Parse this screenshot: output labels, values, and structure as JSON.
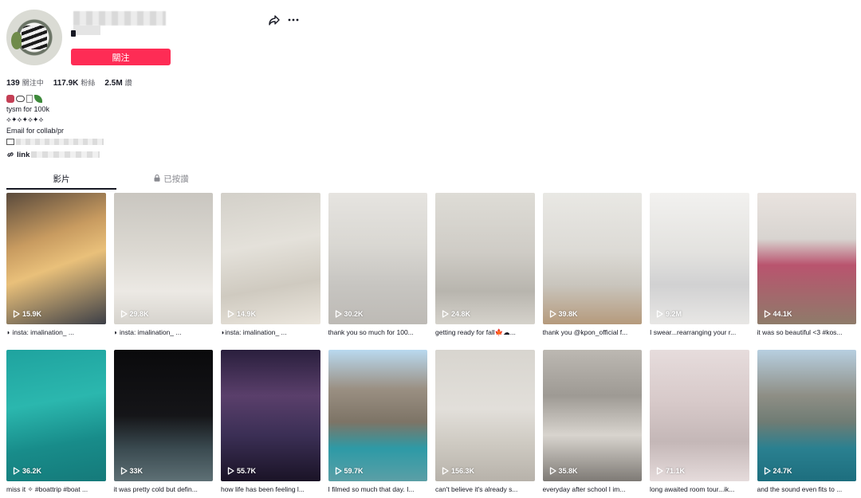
{
  "profile": {
    "follow_label": "關注",
    "stats": [
      {
        "value": "139",
        "label": "關注中"
      },
      {
        "value": "117.9K",
        "label": "粉絲"
      },
      {
        "value": "2.5M",
        "label": "讚"
      }
    ],
    "bio": {
      "line2": "tysm for 100k",
      "line3": "⟡✦⟡✦⟡✦⟡",
      "line4": "Email for collab/pr",
      "link_label": "link"
    }
  },
  "tabs": [
    {
      "label": "影片",
      "active": true
    },
    {
      "label": "已按讚",
      "active": false,
      "icon": "lock-icon"
    }
  ],
  "videos": [
    {
      "views": "15.9K",
      "caption": "◗ insta: imalination_ ..."
    },
    {
      "views": "29.8K",
      "caption": "◗ insta: imalination_ ..."
    },
    {
      "views": "14.9K",
      "caption": "◗insta: imalination_ ..."
    },
    {
      "views": "30.2K",
      "caption": "thank you so much for 100..."
    },
    {
      "views": "24.8K",
      "caption": "getting ready for fall🍁☁..."
    },
    {
      "views": "39.8K",
      "caption": "thank you @kpon_official f..."
    },
    {
      "views": "9.2M",
      "caption": "I swear...rearranging your r..."
    },
    {
      "views": "44.1K",
      "caption": "it was so beautiful <3 #kos..."
    },
    {
      "views": "36.2K",
      "caption": "miss it ✧ #boattrip #boat ..."
    },
    {
      "views": "33K",
      "caption": "it was pretty cold but defin..."
    },
    {
      "views": "55.7K",
      "caption": "how life has been feeling l..."
    },
    {
      "views": "59.7K",
      "caption": "I filmed so much that day. I..."
    },
    {
      "views": "156.3K",
      "caption": "can't believe it's already s..."
    },
    {
      "views": "35.8K",
      "caption": "everyday after school I im..."
    },
    {
      "views": "71.1K",
      "caption": "long awaited room tour...ik..."
    },
    {
      "views": "24.7K",
      "caption": "and the sound even fits to ..."
    }
  ],
  "colors": {
    "accent": "#fe2c55",
    "text": "#161823",
    "muted": "#8a8b91"
  }
}
